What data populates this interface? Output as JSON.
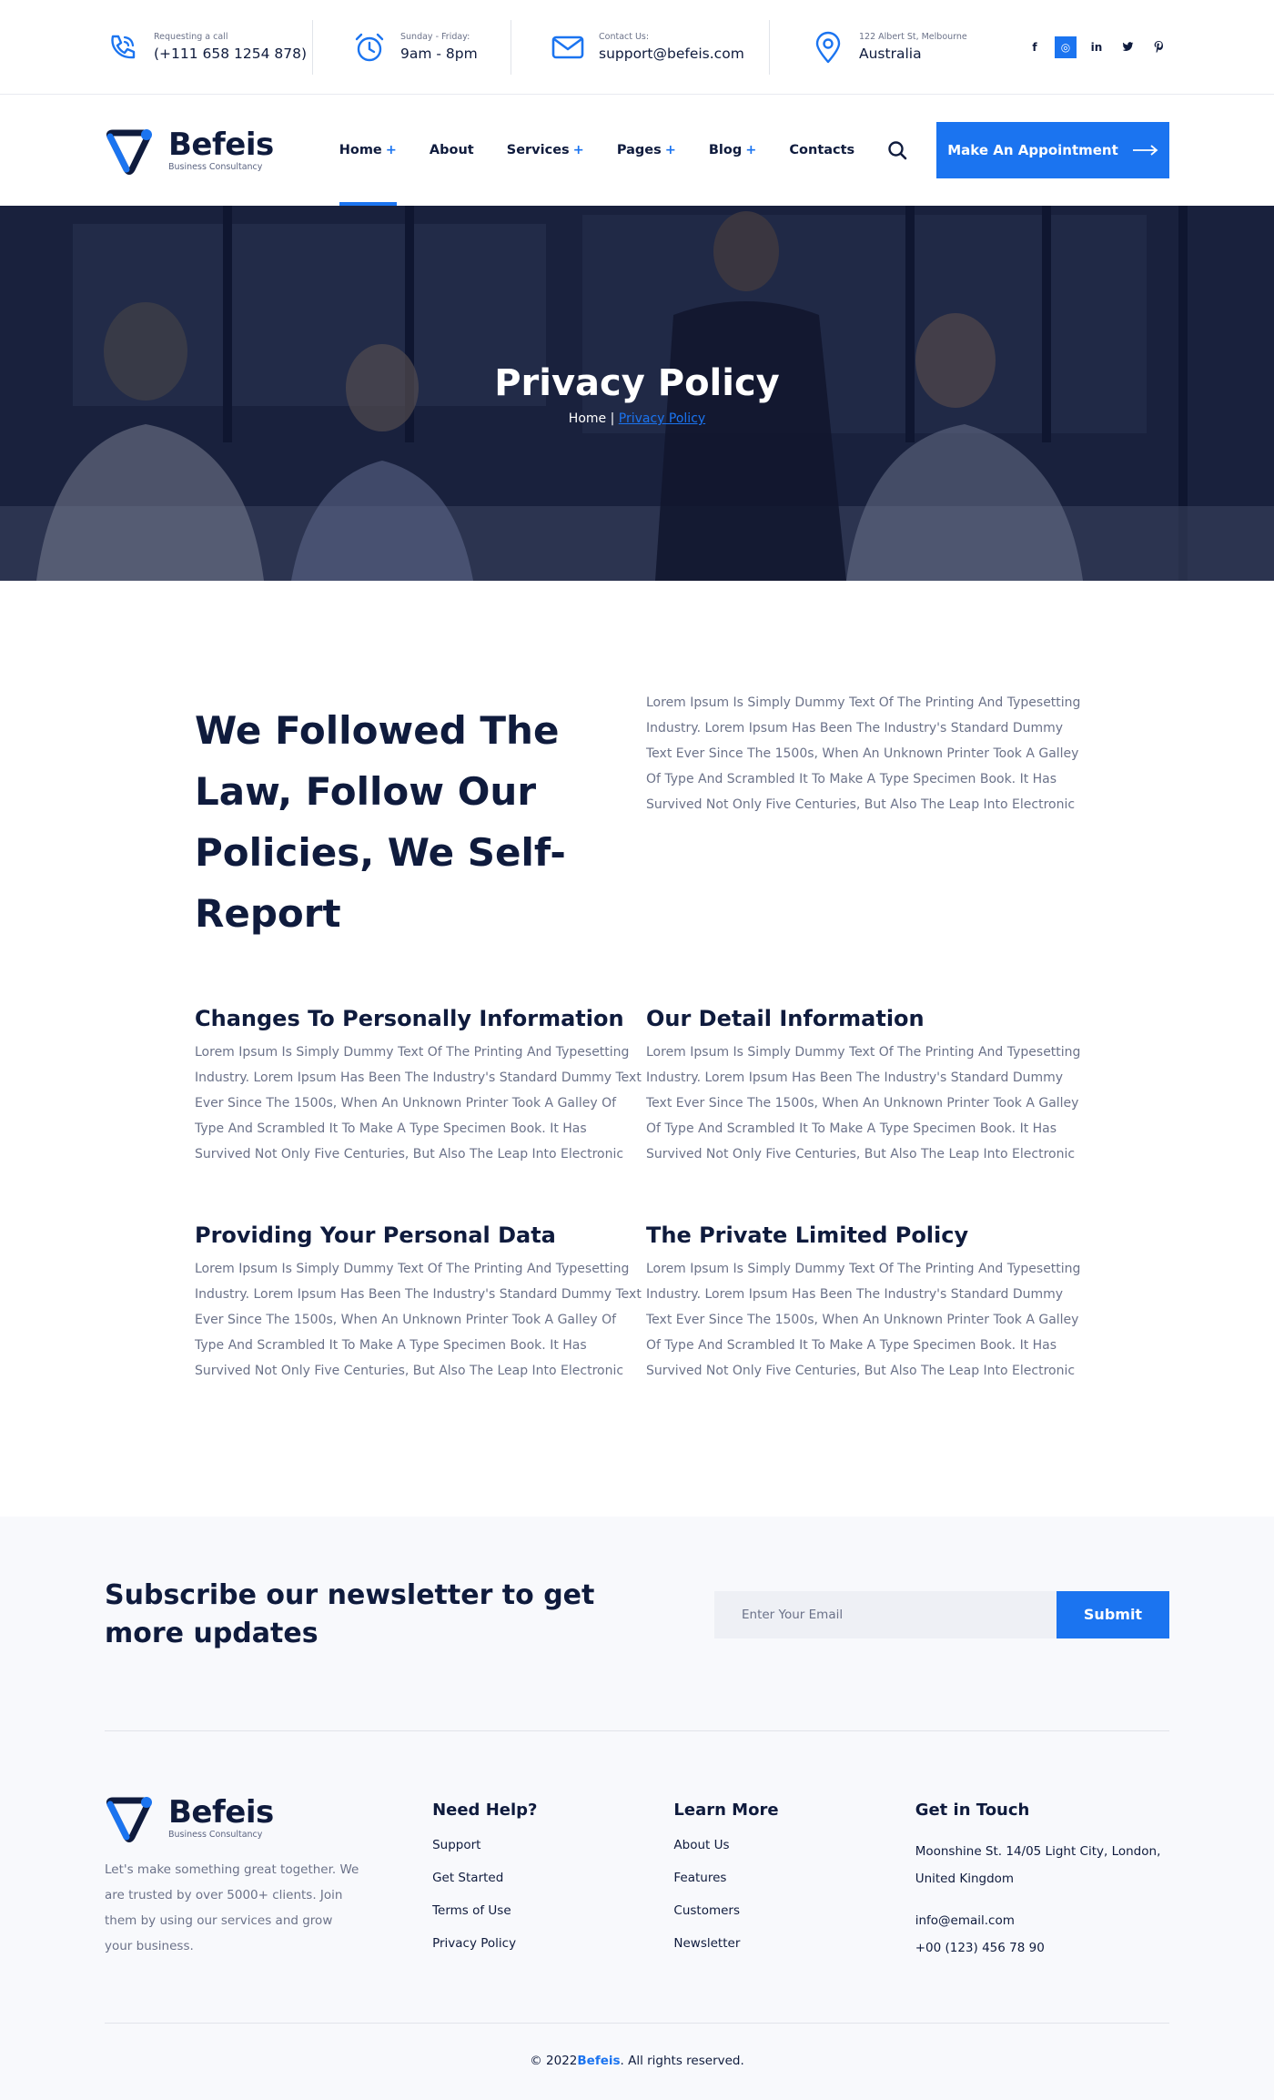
{
  "topbar": {
    "call": {
      "small": "Requesting a call",
      "value": "(+111 658 1254 878)",
      "icon": "phone-icon"
    },
    "hours": {
      "small": "Sunday - Friday:",
      "value": "9am - 8pm",
      "icon": "alarm-clock-icon"
    },
    "email": {
      "small": "Contact Us:",
      "value": "support@befeis.com",
      "icon": "envelope-icon"
    },
    "address": {
      "small": "122 Albert St, Melbourne",
      "value": "Australia",
      "icon": "map-pin-icon"
    },
    "social": [
      "f",
      "◎",
      "in",
      "🐦",
      "P"
    ]
  },
  "brand": {
    "name": "Befeis",
    "tagline": "Business Consultancy",
    "accent": "#1b74f0",
    "dark": "#0f1b3d"
  },
  "nav": {
    "items": [
      {
        "label": "Home",
        "plus": "+"
      },
      {
        "label": "About",
        "plus": ""
      },
      {
        "label": "Services",
        "plus": "+"
      },
      {
        "label": "Pages",
        "plus": "+"
      },
      {
        "label": "Blog",
        "plus": "+"
      },
      {
        "label": "Contacts",
        "plus": ""
      }
    ],
    "cta": "Make An Appointment"
  },
  "hero": {
    "title": "Privacy Policy",
    "crumb_home": "Home",
    "crumb_sep": " | ",
    "crumb_current": "Privacy Policy"
  },
  "intro": {
    "heading": "We Followed The Law, Follow Our Policies, We Self-Report",
    "text": "Lorem Ipsum Is Simply Dummy Text Of The Printing And Typesetting Industry. Lorem Ipsum Has Been The Industry's Standard Dummy Text Ever Since The 1500s, When An Unknown Printer Took A Galley Of Type And Scrambled It To Make A Type Specimen Book. It Has Survived Not Only Five Centuries, But Also The Leap Into Electronic"
  },
  "sections": [
    {
      "title": "Changes To Personally Information",
      "text": "Lorem Ipsum Is Simply Dummy Text Of The Printing And Typesetting Industry. Lorem Ipsum Has Been The Industry's Standard Dummy Text Ever Since The 1500s, When An Unknown Printer Took A Galley Of Type And Scrambled It To Make A Type Specimen Book. It Has Survived Not Only Five Centuries, But Also The Leap Into Electronic"
    },
    {
      "title": "Our Detail Information",
      "text": "Lorem Ipsum Is Simply Dummy Text Of The Printing And Typesetting Industry. Lorem Ipsum Has Been The Industry's Standard Dummy Text Ever Since The 1500s, When An Unknown Printer Took A Galley Of Type And Scrambled It To Make A Type Specimen Book. It Has Survived Not Only Five Centuries, But Also The Leap Into Electronic"
    },
    {
      "title": "Providing Your Personal Data",
      "text": "Lorem Ipsum Is Simply Dummy Text Of The Printing And Typesetting Industry. Lorem Ipsum Has Been The Industry's Standard Dummy Text Ever Since The 1500s, When An Unknown Printer Took A Galley Of Type And Scrambled It To Make A Type Specimen Book. It Has Survived Not Only Five Centuries, But Also The Leap Into Electronic"
    },
    {
      "title": "The Private Limited Policy",
      "text": "Lorem Ipsum Is Simply Dummy Text Of The Printing And Typesetting Industry. Lorem Ipsum Has Been The Industry's Standard Dummy Text Ever Since The 1500s, When An Unknown Printer Took A Galley Of Type And Scrambled It To Make A Type Specimen Book. It Has Survived Not Only Five Centuries, But Also The Leap Into Electronic"
    }
  ],
  "newsletter": {
    "heading": "Subscribe our newsletter to get more updates",
    "placeholder": "Enter Your Email",
    "button": "Submit"
  },
  "footer": {
    "about": "Let's make something great together. We are trusted by over 5000+ clients. Join them by using our services and grow your business.",
    "help": {
      "title": "Need Help?",
      "links": [
        "Support",
        "Get Started",
        "Terms of Use",
        "Privacy Policy"
      ]
    },
    "learn": {
      "title": "Learn More",
      "links": [
        "About Us",
        "Features",
        "Customers",
        "Newsletter"
      ]
    },
    "touch": {
      "title": "Get in Touch",
      "address": "Moonshine St. 14/05 Light City, London, United Kingdom",
      "email": "info@email.com",
      "phone": "+00 (123) 456 78 90"
    },
    "copyright_prefix": "© 2022 ",
    "copyright_brand": "Befeis",
    "copyright_suffix": ". All rights reserved."
  }
}
